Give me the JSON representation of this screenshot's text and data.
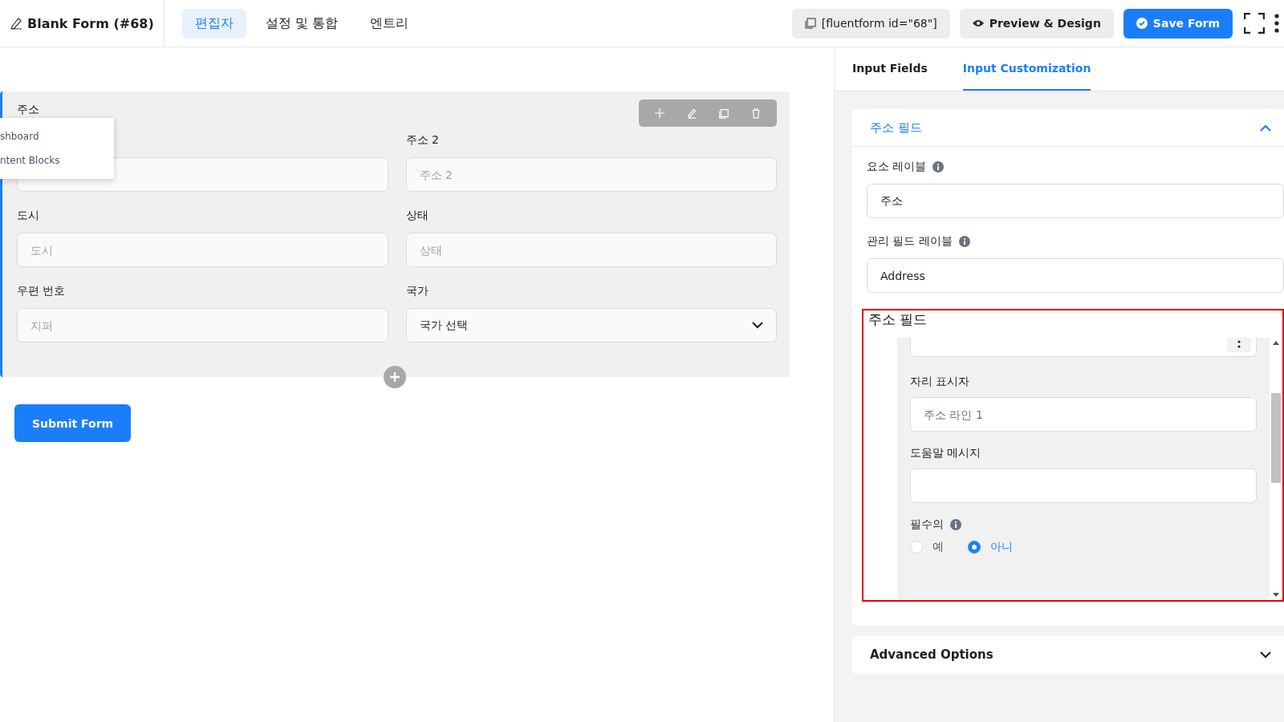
{
  "header": {
    "title": "Blank Form (#68)",
    "tabs": [
      {
        "label": "편집자",
        "selected": true
      },
      {
        "label": "설정 및 통합",
        "selected": false
      },
      {
        "label": "엔트리",
        "selected": false
      }
    ],
    "shortcode": "[fluentform id=\"68\"]",
    "preview": "Preview & Design",
    "save": "Save Form"
  },
  "form": {
    "group_label": "주소",
    "fields": [
      {
        "label": "주소 2",
        "placeholder": "주소 2",
        "kind": "input"
      },
      {
        "label": "도시",
        "placeholder": "도시",
        "kind": "input"
      },
      {
        "label": "상태",
        "placeholder": "상태",
        "kind": "input"
      },
      {
        "label": "우편 번호",
        "placeholder": "지퍼",
        "kind": "input"
      },
      {
        "label": "국가",
        "value": "국가 선택",
        "kind": "select"
      }
    ],
    "submit": "Submit Form"
  },
  "popup_menu": [
    "shboard",
    "ntent Blocks"
  ],
  "panel": {
    "tabs": [
      {
        "label": "Input Fields",
        "selected": false
      },
      {
        "label": "Input Customization",
        "selected": true
      }
    ],
    "section": {
      "title": "주소 필드",
      "expanded": true,
      "fields": [
        {
          "label": "요소 레이블",
          "value": "주소"
        },
        {
          "label": "관리 필드 레이블",
          "value": "Address"
        }
      ],
      "subsection": {
        "title": "주소 필드",
        "placeholder_label": "자리 표시자",
        "placeholder_value": "주소 라인 1",
        "help_label": "도움말 메시지",
        "required_label": "필수의",
        "options": [
          {
            "label": "예",
            "selected": false
          },
          {
            "label": "아니",
            "selected": true
          }
        ]
      }
    },
    "advanced": {
      "title": "Advanced Options",
      "expanded": false
    }
  }
}
